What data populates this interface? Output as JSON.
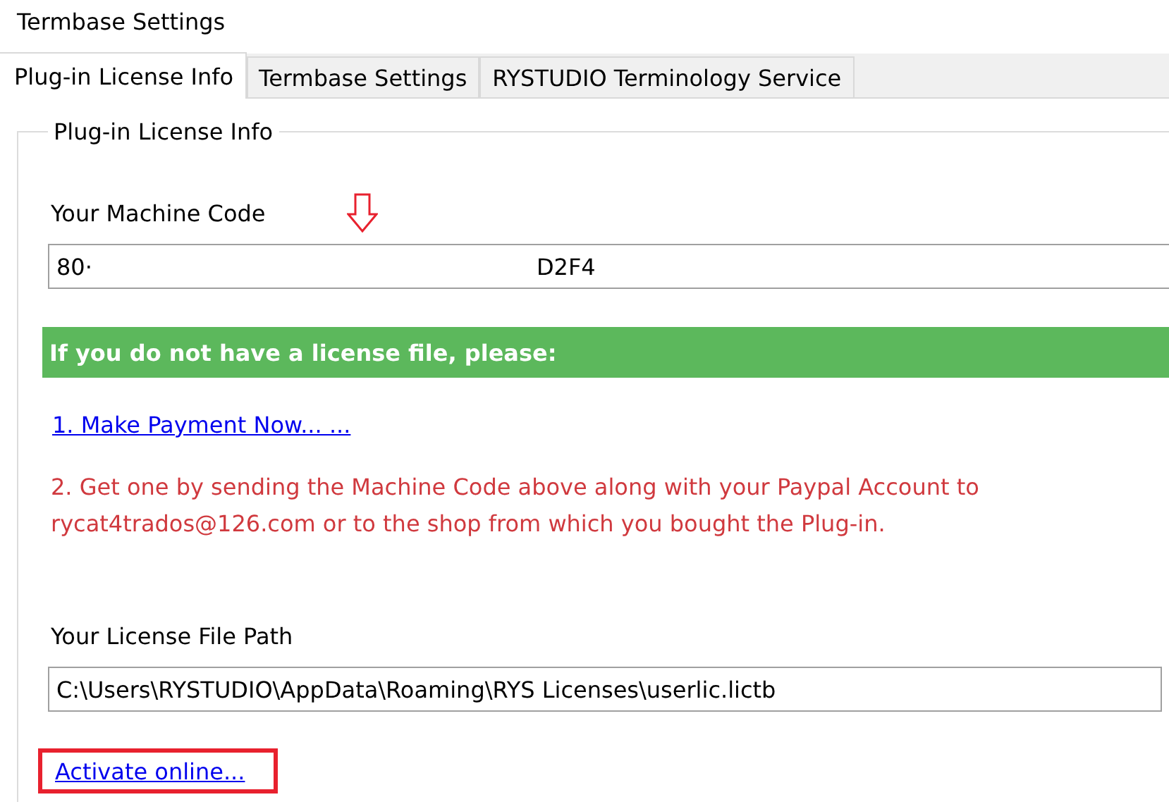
{
  "window": {
    "title": "Termbase Settings"
  },
  "tabs": [
    {
      "label": "Plug-in License Info",
      "selected": true
    },
    {
      "label": "Termbase Settings",
      "selected": false
    },
    {
      "label": "RYSTUDIO Terminology Service",
      "selected": false
    }
  ],
  "group": {
    "title": "Plug-in License Info",
    "machine_code": {
      "label": "Your Machine Code",
      "value_start": "80·",
      "value_end": "D2F4"
    },
    "banner": "If you do not have a license file, please:",
    "payment_link": "1. Make Payment Now... ...",
    "instruction": "2. Get one by sending the Machine Code above along with your Paypal Account to rycat4trados@126.com or to the shop from which you bought the Plug-in.",
    "license_path": {
      "label": "Your License File Path",
      "value": "C:\\Users\\RYSTUDIO\\AppData\\Roaming\\RYS Licenses\\userlic.lictb"
    },
    "activate_link": {
      "label": "Activate online...",
      "highlighted": true
    }
  }
}
